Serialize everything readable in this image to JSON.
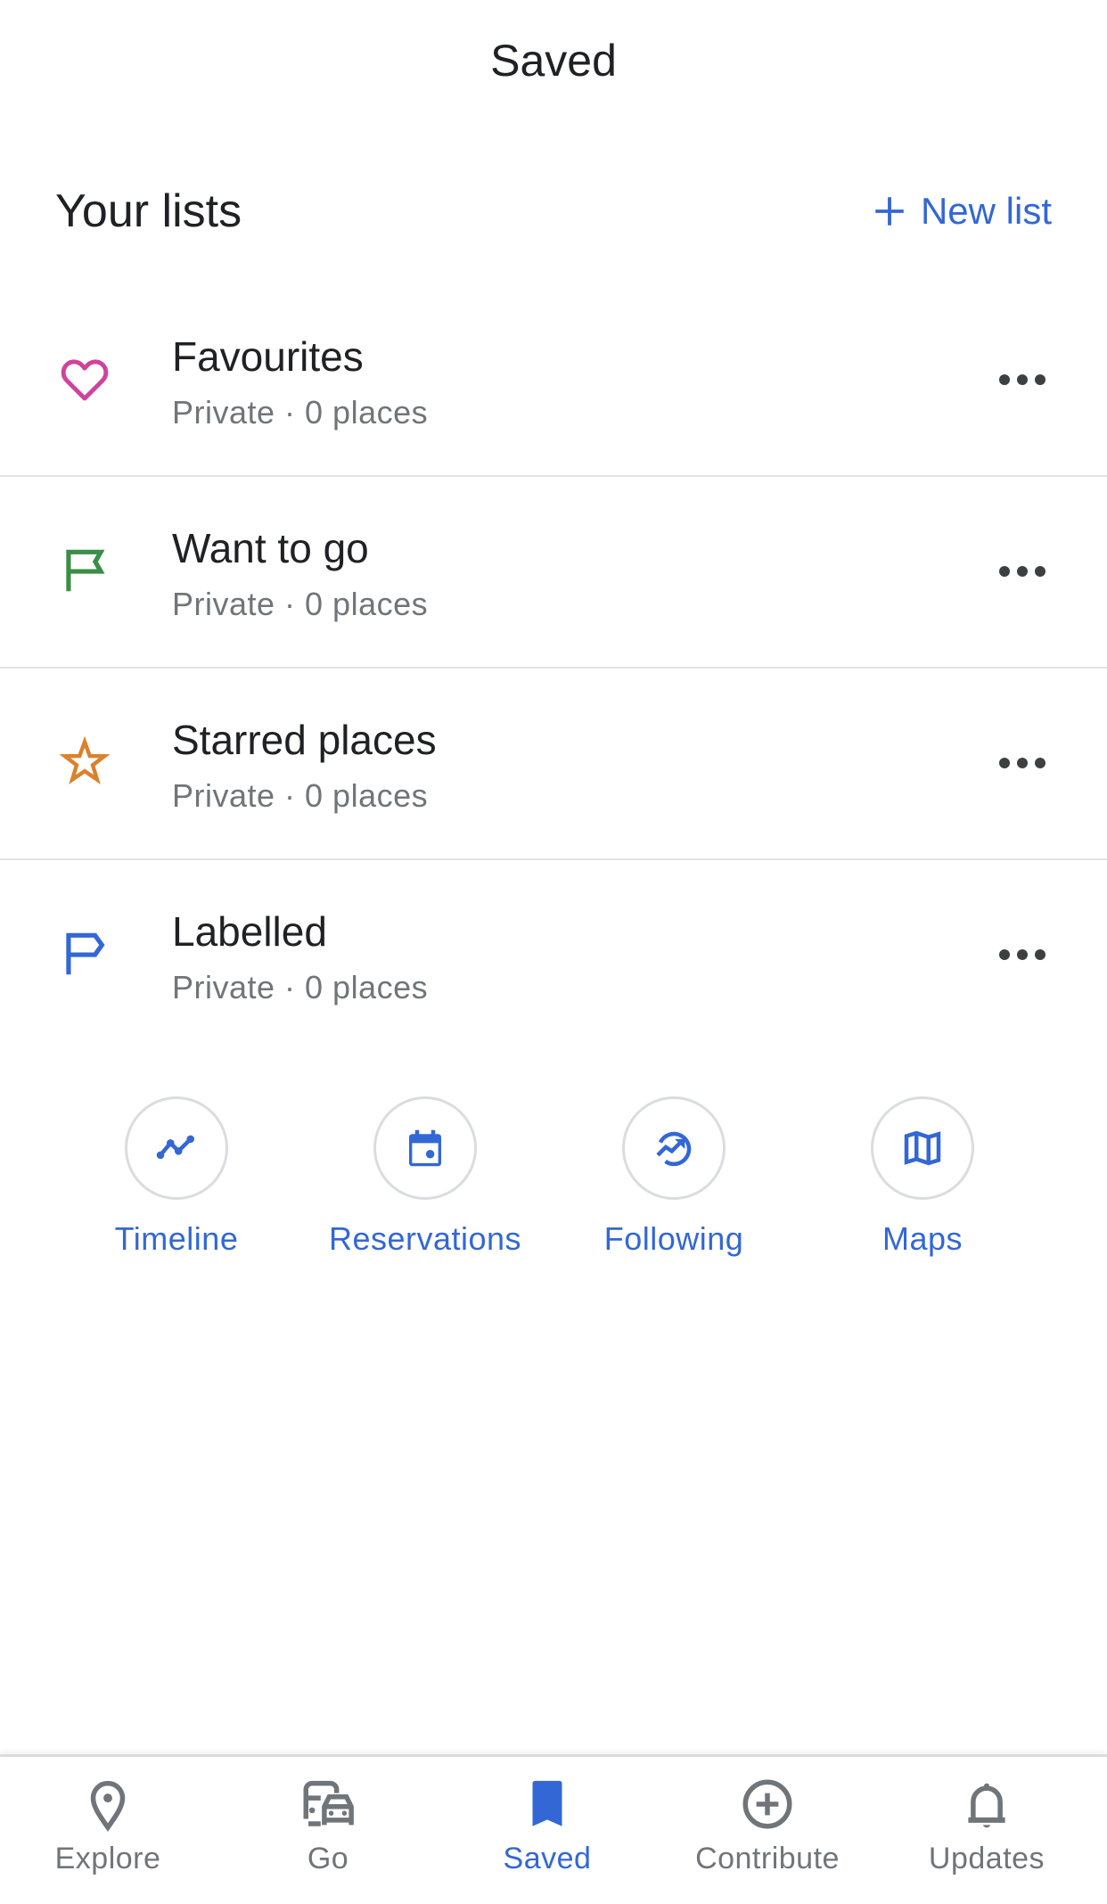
{
  "header": {
    "title": "Saved"
  },
  "lists_section": {
    "title": "Your lists",
    "new_list_label": "New list",
    "new_list_icon": "plus-icon"
  },
  "lists": [
    {
      "title": "Favourites",
      "subtitle": "Private · 0 places",
      "icon": "heart-icon",
      "color": "#d0439b"
    },
    {
      "title": "Want to go",
      "subtitle": "Private · 0 places",
      "icon": "flag-icon",
      "color": "#3a8e45"
    },
    {
      "title": "Starred places",
      "subtitle": "Private · 0 places",
      "icon": "star-icon",
      "color": "#d9822b"
    },
    {
      "title": "Labelled",
      "subtitle": "Private · 0 places",
      "icon": "label-flag-icon",
      "color": "#3367d6"
    }
  ],
  "shortcuts": [
    {
      "label": "Timeline",
      "icon": "timeline-icon"
    },
    {
      "label": "Reservations",
      "icon": "calendar-icon"
    },
    {
      "label": "Following",
      "icon": "trending-circle-icon"
    },
    {
      "label": "Maps",
      "icon": "map-icon"
    }
  ],
  "bottom_nav": {
    "items": [
      {
        "label": "Explore",
        "icon": "location-pin-icon",
        "active": false
      },
      {
        "label": "Go",
        "icon": "transit-car-icon",
        "active": false
      },
      {
        "label": "Saved",
        "icon": "bookmark-icon",
        "active": true
      },
      {
        "label": "Contribute",
        "icon": "plus-circle-icon",
        "active": false
      },
      {
        "label": "Updates",
        "icon": "bell-icon",
        "active": false
      }
    ]
  },
  "colors": {
    "accent": "#3367d6",
    "text_primary": "#202124",
    "text_secondary": "#70757a",
    "divider": "#e3e3e3",
    "nav_inactive": "#70757a"
  }
}
